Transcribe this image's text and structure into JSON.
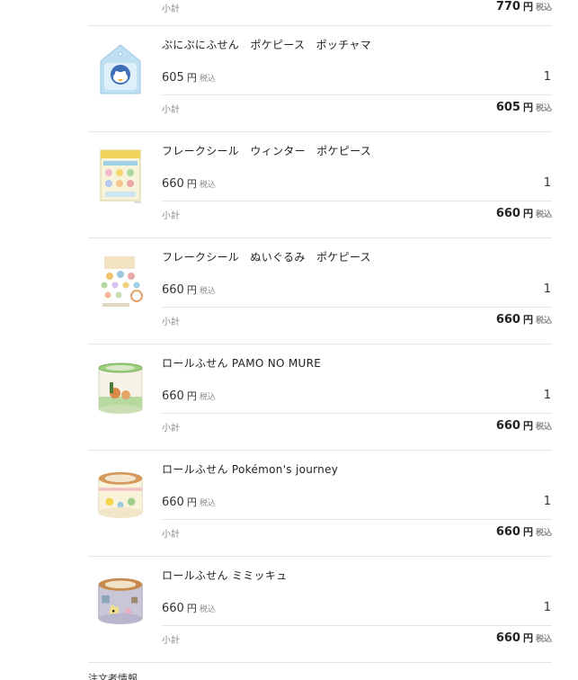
{
  "currency": "円",
  "tax_label": "税込",
  "subtotal_label": "小計",
  "top_partial": {
    "subtotal": "770"
  },
  "items": [
    {
      "name": "ぷにぷにふせん　ポケピース　ポッチャマ",
      "price": "605",
      "quantity": "1",
      "subtotal": "605",
      "image": "pochama-sticky-note-icon"
    },
    {
      "name": "フレークシール　ウィンター　ポケピース",
      "price": "660",
      "quantity": "1",
      "subtotal": "660",
      "image": "flake-sticker-winter-icon"
    },
    {
      "name": "フレークシール　ぬいぐるみ　ポケピース",
      "price": "660",
      "quantity": "1",
      "subtotal": "660",
      "image": "flake-sticker-plush-icon"
    },
    {
      "name": "ロールふせん PAMO NO MURE",
      "price": "660",
      "quantity": "1",
      "subtotal": "660",
      "image": "roll-sticky-pamo-icon"
    },
    {
      "name": "ロールふせん Pokémon's journey",
      "price": "660",
      "quantity": "1",
      "subtotal": "660",
      "image": "roll-sticky-journey-icon"
    },
    {
      "name": "ロールふせん ミミッキュ",
      "price": "660",
      "quantity": "1",
      "subtotal": "660",
      "image": "roll-sticky-mimikyu-icon"
    }
  ],
  "bottom_heading": "注文者情報"
}
